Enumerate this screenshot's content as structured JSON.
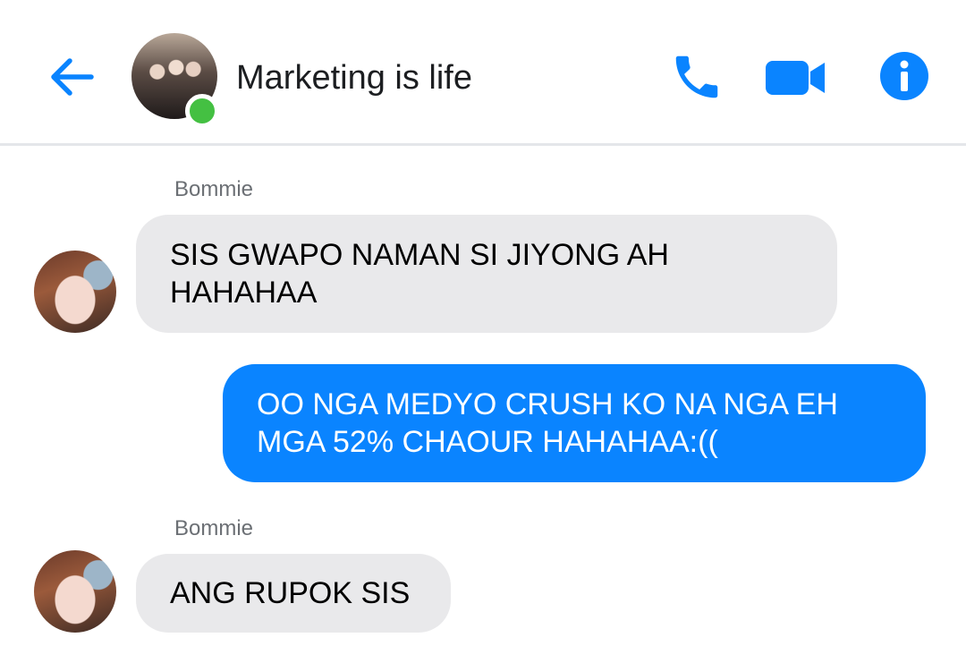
{
  "header": {
    "title": "Marketing is life",
    "back_icon": "back-arrow-icon",
    "call_icon": "phone-icon",
    "video_icon": "video-camera-icon",
    "info_icon": "info-icon",
    "online": true,
    "accent_color": "#0a84ff",
    "online_color": "#44c042"
  },
  "messages": [
    {
      "sender": "Bommie",
      "direction": "incoming",
      "lines": [
        "SIS GWAPO NAMAN SI JIYONG AH",
        "HAHAHAA"
      ]
    },
    {
      "sender": "",
      "direction": "outgoing",
      "lines": [
        "OO NGA MEDYO CRUSH KO NA NGA EH",
        "MGA 52% CHAOUR HAHAHAA:(("
      ]
    },
    {
      "sender": "Bommie",
      "direction": "incoming",
      "lines": [
        "ANG RUPOK SIS"
      ]
    }
  ],
  "colors": {
    "incoming_bubble": "#e9e9eb",
    "outgoing_bubble": "#0a84ff"
  }
}
